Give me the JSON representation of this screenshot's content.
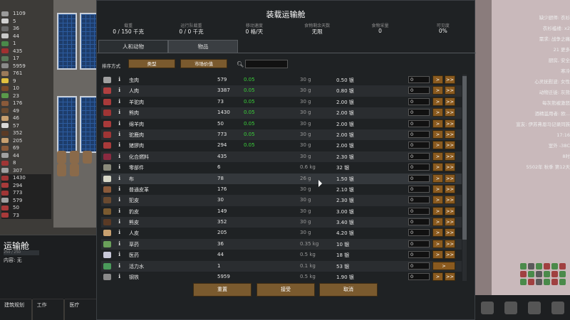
{
  "dialog": {
    "title": "装载运输舱",
    "stats": [
      {
        "label": "载重",
        "value": "0 / 150 千克"
      },
      {
        "label": "运行队载重",
        "value": "0 / 0 千克"
      },
      {
        "label": "移动速度",
        "value": "0 格/天"
      },
      {
        "label": "食物剩余天数",
        "value": "无限"
      },
      {
        "label": "食物采量",
        "value": "0"
      },
      {
        "label": "可见度",
        "value": "0%"
      }
    ],
    "tabs": [
      "人和动物",
      "物品"
    ],
    "sort_label": "排序方式",
    "sort_buttons": [
      "类型",
      "市场价值"
    ],
    "search_placeholder": "",
    "buttons": {
      "reset": "重置",
      "accept": "接受",
      "cancel": "取消"
    }
  },
  "items": [
    {
      "name": "虫肉",
      "count": "579",
      "rate": "0.05",
      "mass": "30 g",
      "value": "0.50 银",
      "qty": "0",
      "icon": "meat-icon",
      "icon_color": "#a0a0a0"
    },
    {
      "name": "人肉",
      "count": "3387",
      "rate": "0.05",
      "mass": "30 g",
      "value": "0.80 银",
      "qty": "0",
      "icon": "meat-icon",
      "icon_color": "#b04040"
    },
    {
      "name": "羊驼肉",
      "count": "73",
      "rate": "0.05",
      "mass": "30 g",
      "value": "2.00 银",
      "qty": "0",
      "icon": "meat-icon",
      "icon_color": "#a83a3a"
    },
    {
      "name": "熊肉",
      "count": "1430",
      "rate": "0.05",
      "mass": "30 g",
      "value": "2.00 银",
      "qty": "0",
      "icon": "meat-icon",
      "icon_color": "#a03535"
    },
    {
      "name": "绵羊肉",
      "count": "50",
      "rate": "0.05",
      "mass": "30 g",
      "value": "2.00 银",
      "qty": "0",
      "icon": "meat-icon",
      "icon_color": "#a83a3a"
    },
    {
      "name": "驼鹿肉",
      "count": "773",
      "rate": "0.05",
      "mass": "30 g",
      "value": "2.00 银",
      "qty": "0",
      "icon": "meat-icon",
      "icon_color": "#a03535"
    },
    {
      "name": "猪猡肉",
      "count": "294",
      "rate": "0.05",
      "mass": "30 g",
      "value": "2.00 银",
      "qty": "0",
      "icon": "meat-icon",
      "icon_color": "#a83a3a"
    },
    {
      "name": "化合燃料",
      "count": "435",
      "rate": "",
      "mass": "30 g",
      "value": "2.30 银",
      "qty": "0",
      "icon": "chemfuel-icon",
      "icon_color": "#8a2a40"
    },
    {
      "name": "零部件",
      "count": "6",
      "rate": "",
      "mass": "0.6 kg",
      "value": "32 银",
      "qty": "0",
      "icon": "component-icon",
      "icon_color": "#8a8a7a"
    },
    {
      "name": "布",
      "count": "78",
      "rate": "",
      "mass": "26 g",
      "value": "1.50 银",
      "qty": "0",
      "icon": "cloth-icon",
      "icon_color": "#d8d8c8"
    },
    {
      "name": "普通皮革",
      "count": "176",
      "rate": "",
      "mass": "30 g",
      "value": "2.10 银",
      "qty": "0",
      "icon": "leather-icon",
      "icon_color": "#8a5a3a"
    },
    {
      "name": "犯皮",
      "count": "30",
      "rate": "",
      "mass": "30 g",
      "value": "2.30 银",
      "qty": "0",
      "icon": "leather-icon",
      "icon_color": "#6a4a30"
    },
    {
      "name": "豹皮",
      "count": "149",
      "rate": "",
      "mass": "30 g",
      "value": "3.00 银",
      "qty": "0",
      "icon": "leather-icon",
      "icon_color": "#7a5a30"
    },
    {
      "name": "熊皮",
      "count": "352",
      "rate": "",
      "mass": "30 g",
      "value": "3.40 银",
      "qty": "0",
      "icon": "leather-icon",
      "icon_color": "#5a3a25"
    },
    {
      "name": "人皮",
      "count": "205",
      "rate": "",
      "mass": "30 g",
      "value": "4.20 银",
      "qty": "0",
      "icon": "leather-icon",
      "icon_color": "#c8a070"
    },
    {
      "name": "草药",
      "count": "36",
      "rate": "",
      "mass": "0.35 kg",
      "value": "10 银",
      "qty": "0",
      "icon": "herbal-medicine-icon",
      "icon_color": "#6aa05a"
    },
    {
      "name": "医药",
      "count": "44",
      "rate": "",
      "mass": "0.5 kg",
      "value": "18 银",
      "qty": "0",
      "icon": "medicine-icon",
      "icon_color": "#c8c8d8"
    },
    {
      "name": "活力水",
      "count": "1",
      "rate": "",
      "mass": "0.1 kg",
      "value": "53 银",
      "qty": "0",
      "icon": "go-juice-icon",
      "icon_color": "#4a9a5a"
    },
    {
      "name": "钢铁",
      "count": "5959",
      "rate": "",
      "mass": "0.5 kg",
      "value": "1.90 银",
      "qty": "0",
      "icon": "steel-icon",
      "icon_color": "#8a8a8a"
    }
  ],
  "resources": [
    {
      "value": "1109",
      "color": "#9a9a9a"
    },
    {
      "value": "5",
      "color": "#d0d0d0"
    },
    {
      "value": "36",
      "color": "#6a6a6a"
    },
    {
      "value": "44",
      "color": "#c8c8c8"
    },
    {
      "value": "1",
      "color": "#4a8a4a"
    },
    {
      "value": "435",
      "color": "#a03030"
    },
    {
      "value": "17",
      "color": "#5a7a5a"
    },
    {
      "value": "5959",
      "color": "#8a8a8a"
    },
    {
      "value": "761",
      "color": "#9a7a5a"
    },
    {
      "value": "9",
      "color": "#e0c040"
    },
    {
      "value": "10",
      "color": "#7a4a2a"
    },
    {
      "value": "23",
      "color": "#5a9a4a"
    },
    {
      "value": "176",
      "color": "#8a5a3a"
    },
    {
      "value": "49",
      "color": "#6a4a30"
    },
    {
      "value": "46",
      "color": "#c8a070"
    },
    {
      "value": "57",
      "color": "#d8d8d8"
    },
    {
      "value": "352",
      "color": "#5a3a25"
    },
    {
      "value": "205",
      "color": "#c8a070"
    },
    {
      "value": "69",
      "color": "#8a5a3a"
    },
    {
      "value": "44",
      "color": "#a0a0a0"
    },
    {
      "value": "8",
      "color": "#a03535"
    },
    {
      "value": "307",
      "color": "#a0a0a0"
    },
    {
      "value": "1430",
      "color": "#a03535"
    },
    {
      "value": "294",
      "color": "#a83a3a"
    },
    {
      "value": "773",
      "color": "#a03535"
    },
    {
      "value": "579",
      "color": "#a0a0a0"
    },
    {
      "value": "50",
      "color": "#a83a3a"
    },
    {
      "value": "73",
      "color": "#a83a3a"
    }
  ],
  "info_panel": {
    "title": "运输舱",
    "bar_text": "250 / 250",
    "content": "内容: 无"
  },
  "bottom_tabs": [
    "建筑规划",
    "工作",
    "医疗"
  ],
  "right_messages": [
    "缺少厨师: 衣衫",
    "衣衫褴褛: x2",
    "需求: 战争之痛",
    "21 更多",
    "厨房, 安全",
    "寒冷",
    "心灵抚慰波: 女性",
    "动物迁徙: 灰熊",
    "每灰熊被激怒",
    "酒精滥用者: 欧...",
    "宣友: 伊苏弗恩马记录同族",
    "17:16",
    "室外 -38C",
    "8时",
    "5502年 秋季 第12天"
  ],
  "colors": {
    "accent_button": "#8a5a1f",
    "green_rate": "#3ad13a",
    "dialog_bg": "#1f2224"
  }
}
